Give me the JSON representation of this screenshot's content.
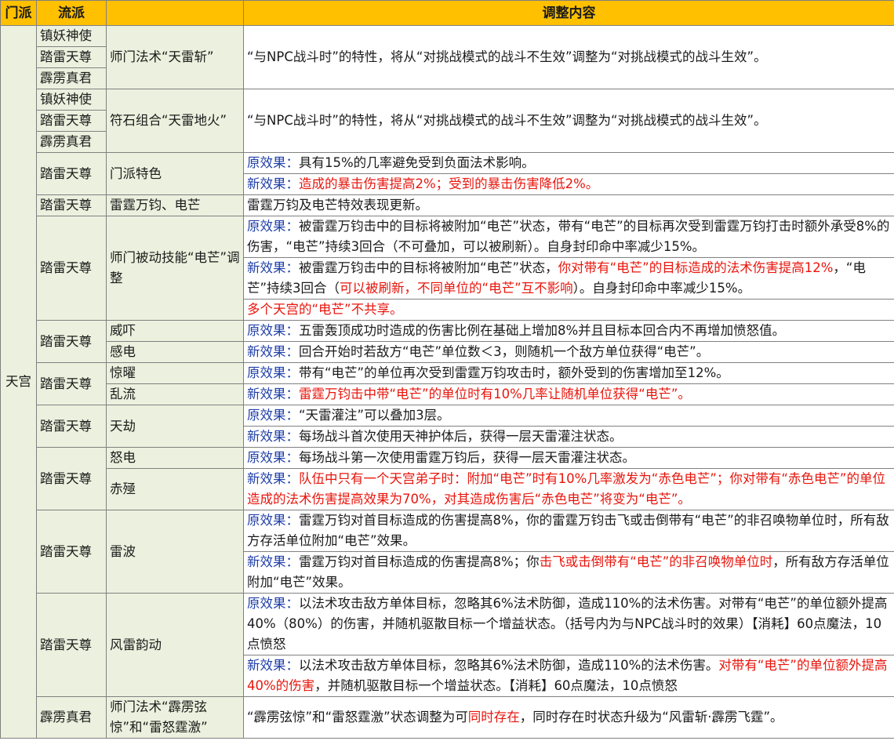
{
  "header": {
    "col_sect": "门派",
    "col_school": "流派",
    "col_content": "调整内容"
  },
  "sect": "天宫",
  "labels": {
    "orig": "原效果：",
    "new": "新效果："
  },
  "schools": {
    "zhenyao": "镇妖神使",
    "talei": "踏雷天尊",
    "pili": "霹雳真君"
  },
  "rows": {
    "r1": {
      "flow": "师门法术“天雷斩”",
      "content": "“与NPC战斗时”的特性，将从“对挑战模式的战斗不生效”调整为“对挑战模式的战斗生效”。"
    },
    "r2": {
      "flow": "符石组合“天雷地火”",
      "content": "“与NPC战斗时”的特性，将从“对挑战模式的战斗不生效”调整为“对挑战模式的战斗生效”。"
    },
    "r3": {
      "flow": "门派特色",
      "orig": "具有15%的几率避免受到负面法术影响。",
      "new_red": "造成的暴击伤害提高2%；受到的暴击伤害降低2%。"
    },
    "r4": {
      "flow": "雷霆万钧、电芒",
      "content": "雷霆万钧及电芒特效表现更新。"
    },
    "r5": {
      "flow": "师门被动技能“电芒”调整",
      "orig": "被雷霆万钧击中的目标将被附加“电芒”状态，带有“电芒”的目标再次受到雷霆万钧打击时额外承受8%的伤害，“电芒”持续3回合（不可叠加，可以被刷新）。自身封印命中率减少15%。",
      "new_a": "被雷霆万钧击中的目标将被附加“电芒”状态，",
      "new_b_red": "你对带有“电芒”的目标造成的法术伤害提高12%",
      "new_c": "，“电芒”持续3回合（",
      "new_d_red": "可以被刷新，不同单位的“电芒”互不影响",
      "new_e": "）。自身封印命中率减少15%。",
      "note_red": "多个天宫的“电芒”不共享。"
    },
    "r6": {
      "flow_a": "威吓",
      "flow_b": "感电",
      "orig": "五雷轰顶成功时造成的伤害比例在基础上增加8%并且目标本回合内不再增加愤怒值。",
      "new": "回合开始时若敌方“电芒”单位数＜3，则随机一个敌方单位获得“电芒”。"
    },
    "r7": {
      "flow_a": "惊曜",
      "flow_b": "乱流",
      "orig": "带有“电芒”的单位再次受到雷霆万钧攻击时，额外受到的伤害增加至12%。",
      "new_red": "雷霆万钧击中带“电芒”的单位时有10%几率让随机单位获得“电芒”。"
    },
    "r8": {
      "flow": "天劫",
      "orig": "“天雷灌注”可以叠加3层。",
      "new": "每场战斗首次使用天神护体后，获得一层天雷灌注状态。"
    },
    "r9": {
      "flow_a": "怒电",
      "flow_b": "赤殛",
      "orig": "每场战斗第一次使用雷霆万钧后，获得一层天雷灌注状态。",
      "new_red": "队伍中只有一个天宫弟子时：附加“电芒”时有10%几率激发为“赤色电芒”；你对带有“赤色电芒”的单位造成的法术伤害提高效果为70%，对其造成伤害后“赤色电芒”将变为“电芒”。"
    },
    "r10": {
      "flow": "雷波",
      "orig": "雷霆万钧对首目标造成的伤害提高8%，你的雷霆万钧击飞或击倒带有“电芒”的非召唤物单位时，所有敌方存活单位附加“电芒”效果。",
      "new_a": "雷霆万钧对首目标造成的伤害提高8%；你",
      "new_b_red": "击飞或击倒带有“电芒”的非召唤物单位时",
      "new_c": "，所有敌方存活单位附加“电芒”效果。"
    },
    "r11": {
      "flow": "风雷韵动",
      "orig": "以法术攻击敌方单体目标，忽略其6%法术防御，造成110%的法术伤害。对带有“电芒”的单位额外提高40%（80%）的伤害，并随机驱散目标一个增益状态。（括号内为与NPC战斗时的效果）【消耗】60点魔法，10点愤怒",
      "new_a": "以法术攻击敌方单体目标，忽略其6%法术防御，造成110%的法术伤害。",
      "new_b_red": "对带有“电芒”的单位额外提高40%的伤害",
      "new_c": "，并随机驱散目标一个增益状态。【消耗】60点魔法，10点愤怒"
    },
    "r12": {
      "flow": "师门法术“霹雳弦惊”和“雷怒霆激”",
      "content_a": "“霹雳弦惊”和“雷怒霆激”状态调整为可",
      "content_b_red": "同时存在",
      "content_c": "，同时存在时状态升级为“风雷斩·霹雳飞霆”。"
    }
  }
}
